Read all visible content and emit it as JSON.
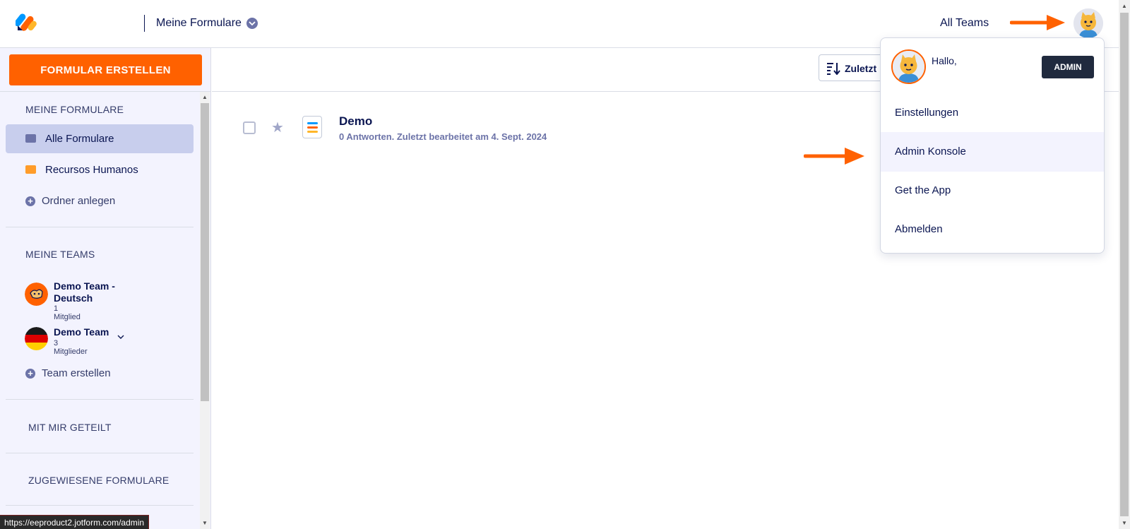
{
  "header": {
    "title": "Meine Formulare",
    "all_teams": "All Teams"
  },
  "sidebar": {
    "create_button": "FORMULAR ERSTELLEN",
    "my_forms_heading": "MEINE FORMULARE",
    "folders": [
      {
        "label": "Alle Formulare",
        "color": "#6c73a8",
        "active": true
      },
      {
        "label": "Recursos Humanos",
        "color": "#ff9c2a",
        "active": false
      }
    ],
    "add_folder": "Ordner anlegen",
    "my_teams_heading": "MEINE TEAMS",
    "teams": [
      {
        "name": "Demo Team - Deutsch",
        "count": "1 Mitglied"
      },
      {
        "name": "Demo Team",
        "count": "3 Mitglieder"
      }
    ],
    "create_team": "Team erstellen",
    "shared_heading": "MIT MIR GETEILT",
    "assigned_heading": "ZUGEWIESENE FORMULARE"
  },
  "toolbar": {
    "sort_label": "Zuletzt"
  },
  "forms": [
    {
      "title": "Demo",
      "meta": "0 Antworten. Zuletzt bearbeitet am 4. Sept. 2024"
    }
  ],
  "dropdown": {
    "greeting": "Hallo,",
    "admin_badge": "ADMIN",
    "items": [
      {
        "label": "Einstellungen"
      },
      {
        "label": "Admin Konsole"
      },
      {
        "label": "Get the App"
      },
      {
        "label": "Abmelden"
      }
    ]
  },
  "status_bar": {
    "url": "https://eeproduct2.jotform.com/admin"
  },
  "colors": {
    "accent": "#ff6100",
    "navy": "#0a1551",
    "sidebar_bg": "#f3f3fe",
    "active_bg": "#c8ceed"
  }
}
